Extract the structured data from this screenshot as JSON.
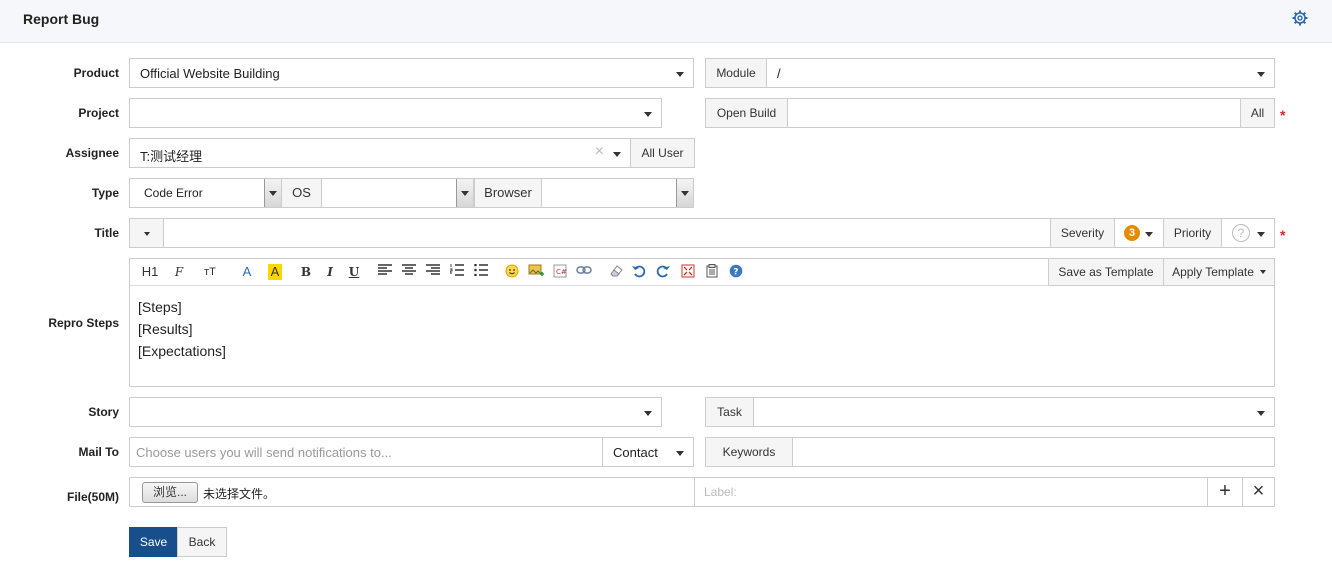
{
  "header": {
    "title": "Report Bug",
    "settings_icon": "gear-icon"
  },
  "form": {
    "product": {
      "label": "Product",
      "value": "Official Website Building"
    },
    "module": {
      "label": "Module",
      "value": "/"
    },
    "project": {
      "label": "Project",
      "value": ""
    },
    "open_build": {
      "label": "Open Build",
      "value": "",
      "all_button": "All",
      "required": "*"
    },
    "assignee": {
      "label": "Assignee",
      "value": "T:测试经理",
      "clear": "×",
      "all_user_button": "All User"
    },
    "type": {
      "label": "Type",
      "value": "Code Error",
      "os_label": "OS",
      "os_value": "",
      "browser_label": "Browser",
      "browser_value": ""
    },
    "title": {
      "label": "Title",
      "value": "",
      "severity_label": "Severity",
      "severity_value": "3",
      "priority_label": "Priority",
      "priority_value": "?",
      "required": "*"
    },
    "repro_steps": {
      "label": "Repro Steps",
      "toolbar": {
        "heading": "H1",
        "font": "F",
        "size": "тT",
        "font_color": "A",
        "highlight": "A",
        "bold": "B",
        "italic": "I",
        "underline": "U",
        "save_template": "Save as Template",
        "apply_template": "Apply Template"
      },
      "content": [
        "[Steps]",
        "[Results]",
        "[Expectations]"
      ]
    },
    "story": {
      "label": "Story",
      "value": ""
    },
    "task": {
      "label": "Task",
      "value": ""
    },
    "mail_to": {
      "label": "Mail To",
      "placeholder": "Choose users you will send notifications to...",
      "contact": "Contact"
    },
    "keywords": {
      "label": "Keywords",
      "value": ""
    },
    "file": {
      "label": "File(50M)",
      "browse": "浏览...",
      "no_file": "未选择文件。",
      "label_placeholder": "Label:",
      "add": "+",
      "remove": "×"
    }
  },
  "actions": {
    "save": "Save",
    "back": "Back"
  },
  "colors": {
    "primary": "#164f8c",
    "required": "#d9252f",
    "severity": "#e68a00",
    "accent": "#2a6bb0"
  }
}
